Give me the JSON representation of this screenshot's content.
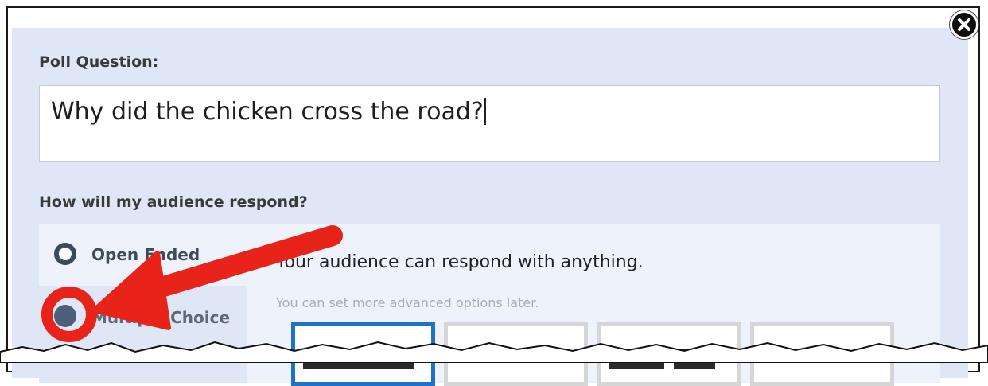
{
  "dialog": {
    "poll_question_label": "Poll Question:",
    "poll_question_value": "Why did the chicken cross the road?",
    "respond_label": "How will my audience respond?",
    "response_types": [
      {
        "label": "Open Ended",
        "selected": true
      },
      {
        "label": "Multiple Choice",
        "selected": false
      }
    ],
    "description": "Your audience can respond with anything.",
    "sub_description": "You can set more advanced options later."
  },
  "icons": {
    "close": "close-icon",
    "radio": "radio-icon",
    "annotation": "arrow-annotation-icon"
  },
  "colors": {
    "panel_bg": "#dfe6f5",
    "selected_tile_border": "#1e73c8",
    "annotation_red": "#e8231a"
  }
}
